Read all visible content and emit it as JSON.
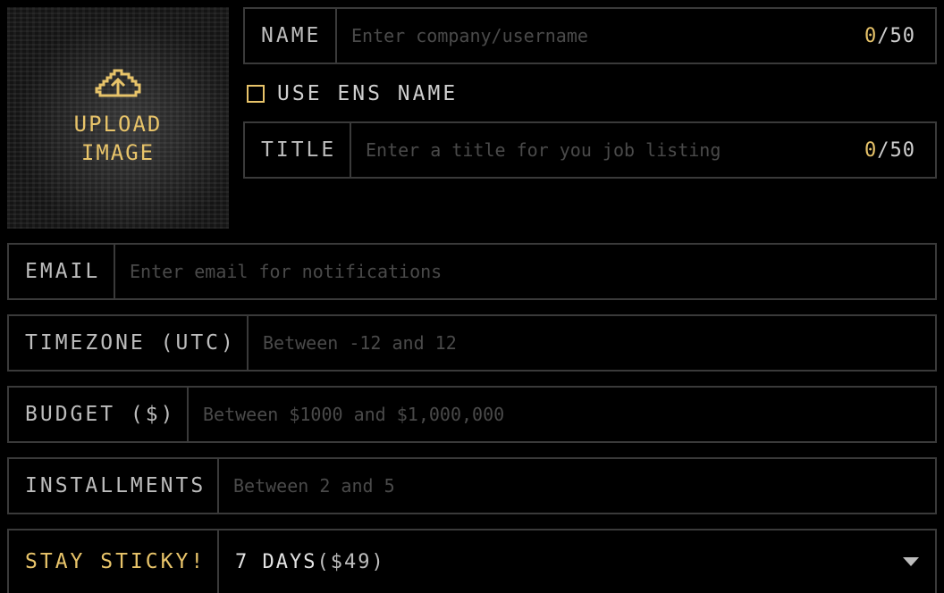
{
  "upload": {
    "label_line1": "UPLOAD",
    "label_line2": "IMAGE",
    "icon": "cloud-upload-icon"
  },
  "name": {
    "label": "NAME",
    "placeholder": "Enter company/username",
    "value": "",
    "count": "0",
    "max": "/50"
  },
  "ens": {
    "label": "USE ENS NAME",
    "checked": false
  },
  "title": {
    "label": "TITLE",
    "placeholder": "Enter a title for you job listing",
    "value": "",
    "count": "0",
    "max": "/50"
  },
  "email": {
    "label": "EMAIL",
    "placeholder": "Enter email for notifications",
    "value": ""
  },
  "timezone": {
    "label": "TIMEZONE (UTC)",
    "placeholder": "Between -12 and 12",
    "value": ""
  },
  "budget": {
    "label": "BUDGET ($)",
    "placeholder": "Between $1000 and $1,000,000",
    "value": ""
  },
  "installments": {
    "label": "INSTALLMENTS",
    "placeholder": "Between 2 and 5",
    "value": ""
  },
  "sticky": {
    "label": "STAY STICKY!",
    "selected_duration": "7 DAYS",
    "selected_price": "($49)"
  },
  "colors": {
    "accent": "#e8c46a",
    "border": "#3a3a3a",
    "background": "#000000"
  }
}
